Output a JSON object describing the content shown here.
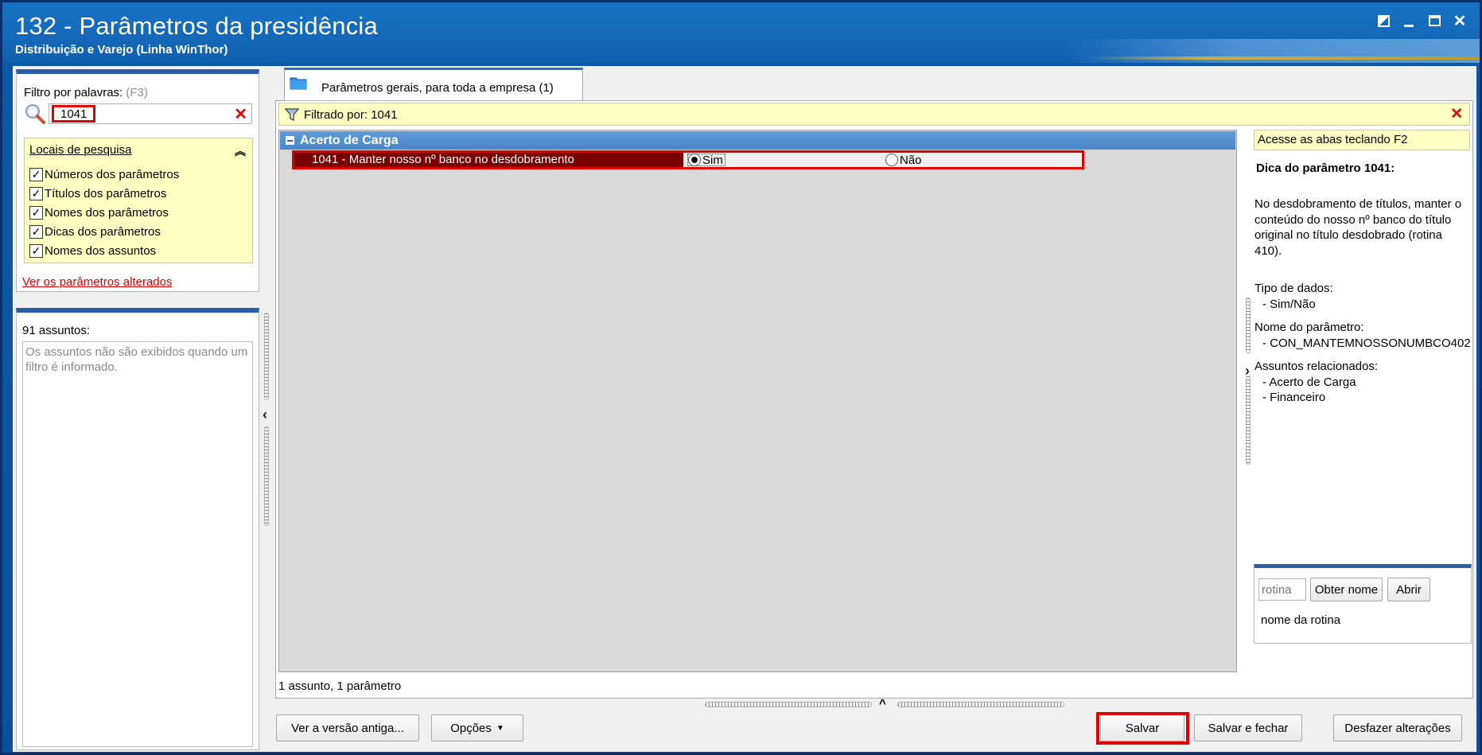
{
  "window": {
    "title": "132 - Parâmetros da presidência",
    "subtitle": "Distribuição e Varejo (Linha WinThor)"
  },
  "filter": {
    "label": "Filtro por palavras:",
    "shortcut": "(F3)",
    "value": "1041",
    "clear_icon": "close-icon"
  },
  "search_locations": {
    "title": "Locais de pesquisa",
    "items": [
      {
        "label": "Números dos parâmetros",
        "checked": true
      },
      {
        "label": "Títulos dos parâmetros",
        "checked": true
      },
      {
        "label": "Nomes dos parâmetros",
        "checked": true
      },
      {
        "label": "Dicas dos parâmetros",
        "checked": true
      },
      {
        "label": "Nomes dos assuntos",
        "checked": true
      }
    ]
  },
  "link_changed": "Ver os parâmetros alterados",
  "subjects": {
    "count_label": "91 assuntos:",
    "note": "Os assuntos não são exibidos quando um filtro é informado."
  },
  "tab": {
    "label": "Parâmetros gerais, para toda a empresa  (1)"
  },
  "filter_bar": {
    "text": "Filtrado por: 1041"
  },
  "group": {
    "title": "Acerto de Carga"
  },
  "parameter": {
    "name": "1041 - Manter nosso nº banco no desdobramento",
    "option_yes": "Sim",
    "option_no": "Não",
    "selected": "Sim"
  },
  "status": {
    "count": "1 assunto, 1 parâmetro"
  },
  "hint": {
    "bar": "Acesse as abas teclando F2",
    "title": "Dica do parâmetro 1041:",
    "body": "No desdobramento de títulos, manter o conteúdo do nosso nº banco do título original no título desdobrado (rotina 410).",
    "data_type_label": "Tipo de dados:",
    "data_type": "- Sim/Não",
    "param_name_label": "Nome do parâmetro:",
    "param_name": "- CON_MANTEMNOSSONUMBCO402",
    "related_label": "Assuntos relacionados:",
    "related": [
      "- Acerto de Carga",
      "- Financeiro"
    ]
  },
  "rotina": {
    "placeholder": "rotina",
    "get_name_button": "Obter nome",
    "open_button": "Abrir",
    "name_label": "nome da rotina"
  },
  "buttons": {
    "old_version": "Ver a versão antiga...",
    "options": "Opções",
    "save": "Salvar",
    "save_close": "Salvar e fechar",
    "undo": "Desfazer alterações"
  },
  "colors": {
    "title_bar": "#1467b8",
    "highlight_red": "#e00000",
    "selected_row": "#7a0000",
    "group_header": "#4a86c8",
    "yellow_panel": "#ffffc4"
  }
}
